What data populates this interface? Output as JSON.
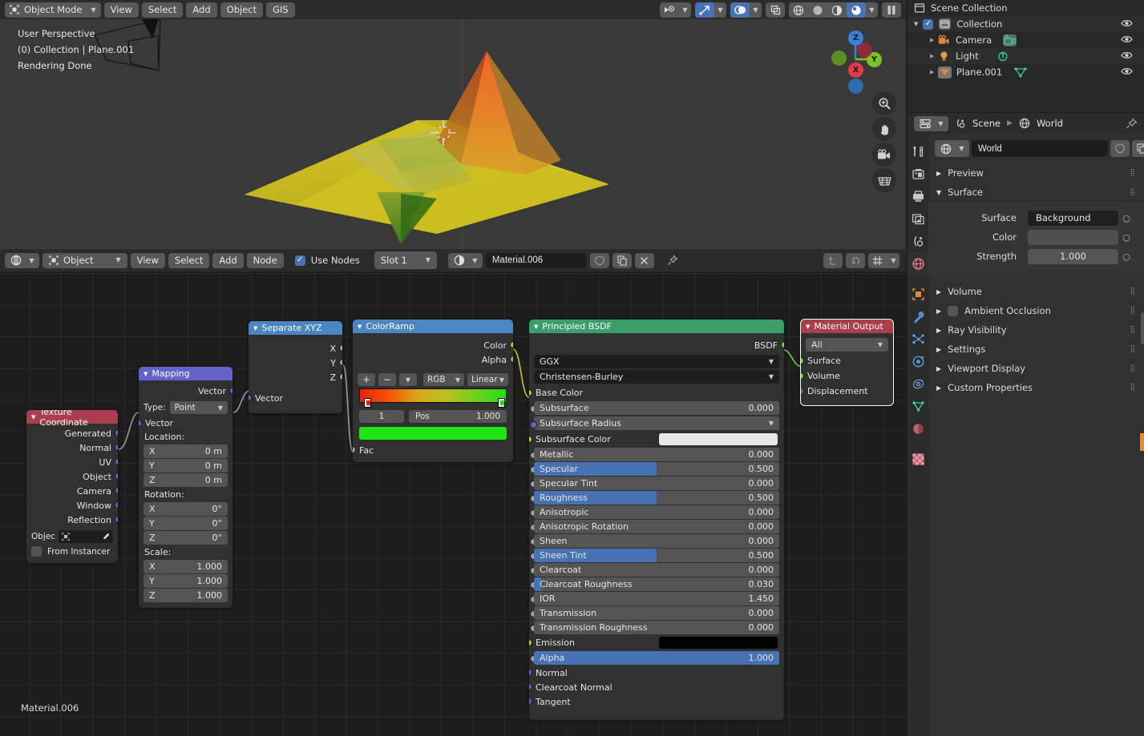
{
  "viewport": {
    "mode": "Object Mode",
    "menus": [
      "View",
      "Select",
      "Add",
      "Object",
      "GIS"
    ],
    "overlay_text": [
      "User Perspective",
      "(0) Collection | Plane.001",
      "Rendering Done"
    ],
    "gizmo_axes": [
      "Z",
      "Y",
      "X"
    ],
    "tools": [
      "zoom-tool",
      "pan-tool",
      "camera-tool",
      "ortho-tool"
    ]
  },
  "shader_header": {
    "editor_type": "shader-editor",
    "shader_type": "Object",
    "menus": [
      "View",
      "Select",
      "Add",
      "Node"
    ],
    "use_nodes_label": "Use Nodes",
    "use_nodes_checked": true,
    "slot": "Slot 1",
    "material_name": "Material.006",
    "status_label": "Material.006"
  },
  "nodes": {
    "texture_coordinate": {
      "title": "Texture Coordinate",
      "color": "#a83f4b",
      "outputs": [
        "Generated",
        "Normal",
        "UV",
        "Object",
        "Camera",
        "Window",
        "Reflection"
      ],
      "object_label": "Objec",
      "from_instancer_label": "From Instancer",
      "from_instancer_checked": false
    },
    "mapping": {
      "title": "Mapping",
      "color": "#6262c8",
      "output": "Vector",
      "type_label": "Type:",
      "type_value": "Point",
      "input": "Vector",
      "location_label": "Location:",
      "location": [
        {
          "axis": "X",
          "value": "0 m"
        },
        {
          "axis": "Y",
          "value": "0 m"
        },
        {
          "axis": "Z",
          "value": "0 m"
        }
      ],
      "rotation_label": "Rotation:",
      "rotation": [
        {
          "axis": "X",
          "value": "0°"
        },
        {
          "axis": "Y",
          "value": "0°"
        },
        {
          "axis": "Z",
          "value": "0°"
        }
      ],
      "scale_label": "Scale:",
      "scale": [
        {
          "axis": "X",
          "value": "1.000"
        },
        {
          "axis": "Y",
          "value": "1.000"
        },
        {
          "axis": "Z",
          "value": "1.000"
        }
      ]
    },
    "separate_xyz": {
      "title": "Separate XYZ",
      "color": "#4a85c4",
      "outputs": [
        "X",
        "Y",
        "Z"
      ],
      "input": "Vector"
    },
    "color_ramp": {
      "title": "ColorRamp",
      "color": "#4a85c4",
      "outputs": [
        "Color",
        "Alpha"
      ],
      "add_label": "+",
      "remove_label": "−",
      "interpolation_mode": "RGB",
      "interpolation_type": "Linear",
      "gradient_from": "#f01e00",
      "gradient_mid": "#cfa81a",
      "gradient_to": "#21e016",
      "index": "1",
      "pos_label": "Pos",
      "pos_value": "1.000",
      "selected_color": "#1fe612",
      "input": "Fac"
    },
    "principled_bsdf": {
      "title": "Principled BSDF",
      "color": "#3a9e6b",
      "output": "BSDF",
      "distribution": "GGX",
      "subsurface_method": "Christensen-Burley",
      "base_color_label": "Base Color",
      "subsurface_radius_label": "Subsurface Radius",
      "subsurface_color_label": "Subsurface Color",
      "subsurface_color_value": "#e8e8e8",
      "emission_label": "Emission",
      "emission_color": "#000000",
      "properties": [
        {
          "label": "Subsurface",
          "value": "0.000",
          "fill": 0
        },
        {
          "label": "Metallic",
          "value": "0.000",
          "fill": 0
        },
        {
          "label": "Specular",
          "value": "0.500",
          "fill": 50
        },
        {
          "label": "Specular Tint",
          "value": "0.000",
          "fill": 0
        },
        {
          "label": "Roughness",
          "value": "0.500",
          "fill": 50
        },
        {
          "label": "Anisotropic",
          "value": "0.000",
          "fill": 0
        },
        {
          "label": "Anisotropic Rotation",
          "value": "0.000",
          "fill": 0
        },
        {
          "label": "Sheen",
          "value": "0.000",
          "fill": 0
        },
        {
          "label": "Sheen Tint",
          "value": "0.500",
          "fill": 50
        },
        {
          "label": "Clearcoat",
          "value": "0.000",
          "fill": 0
        },
        {
          "label": "Clearcoat Roughness",
          "value": "0.030",
          "fill": 3
        },
        {
          "label": "IOR",
          "value": "1.450",
          "fill": 0
        },
        {
          "label": "Transmission",
          "value": "0.000",
          "fill": 0
        },
        {
          "label": "Transmission Roughness",
          "value": "0.000",
          "fill": 0
        },
        {
          "label": "Alpha",
          "value": "1.000",
          "fill": 100
        }
      ],
      "vector_inputs": [
        "Normal",
        "Clearcoat Normal",
        "Tangent"
      ]
    },
    "material_output": {
      "title": "Material Output",
      "color": "#a83f4b",
      "target": "All",
      "inputs": [
        "Surface",
        "Volume",
        "Displacement"
      ]
    }
  },
  "outliner": {
    "root": "Scene Collection",
    "items": [
      {
        "label": "Collection",
        "icon": "collection-icon",
        "checked": true
      },
      {
        "label": "Camera",
        "icon": "camera-icon"
      },
      {
        "label": "Light",
        "icon": "light-icon"
      },
      {
        "label": "Plane.001",
        "icon": "mesh-icon"
      }
    ]
  },
  "properties": {
    "breadcrumb": [
      "Scene",
      "World"
    ],
    "datablock_name": "World",
    "sections": [
      {
        "label": "Preview",
        "open": false
      },
      {
        "label": "Surface",
        "open": true
      },
      {
        "label": "Volume",
        "open": false
      },
      {
        "label": "Ambient Occlusion",
        "open": false,
        "checkbox": true
      },
      {
        "label": "Ray Visibility",
        "open": false
      },
      {
        "label": "Settings",
        "open": false
      },
      {
        "label": "Viewport Display",
        "open": false
      },
      {
        "label": "Custom Properties",
        "open": false
      }
    ],
    "surface_fields": [
      {
        "label": "Surface",
        "value": "Background",
        "kind": "dropdown"
      },
      {
        "label": "Color",
        "value": "",
        "kind": "color",
        "color": "#4f4f4f"
      },
      {
        "label": "Strength",
        "value": "1.000",
        "kind": "number"
      }
    ]
  }
}
